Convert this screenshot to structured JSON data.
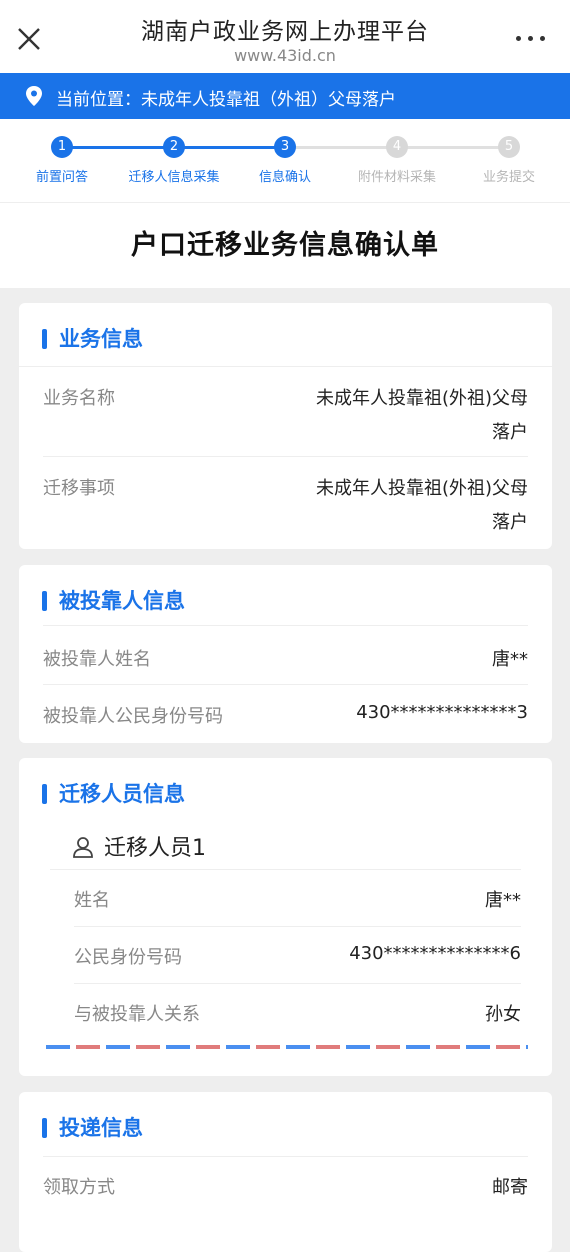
{
  "header": {
    "title": "湖南户政业务网上办理平台",
    "url": "www.43id.cn",
    "close_icon": "close-icon",
    "more_icon": "more-icon"
  },
  "location": {
    "icon": "pin-icon",
    "text": "当前位置：未成年人投靠祖（外祖）父母落户"
  },
  "steps": [
    {
      "num": "1",
      "label": "前置问答",
      "state": "active"
    },
    {
      "num": "2",
      "label": "迁移人信息采集",
      "state": "active"
    },
    {
      "num": "3",
      "label": "信息确认",
      "state": "active"
    },
    {
      "num": "4",
      "label": "附件材料采集",
      "state": "inactive"
    },
    {
      "num": "5",
      "label": "业务提交",
      "state": "inactive"
    }
  ],
  "form_title": "户口迁移业务信息确认单",
  "business": {
    "title": "业务信息",
    "rows": [
      {
        "key": "业务名称",
        "value_line1": "未成年人投靠祖(外祖)父母",
        "value_line2": "落户"
      },
      {
        "key": "迁移事项",
        "value_line1": "未成年人投靠祖(外祖)父母",
        "value_line2": "落户"
      }
    ]
  },
  "relied": {
    "title": "被投靠人信息",
    "rows": [
      {
        "key": "被投靠人姓名",
        "value": "唐**"
      },
      {
        "key": "被投靠人公民身份号码",
        "value": "430**************3"
      }
    ]
  },
  "migrants": {
    "title": "迁移人员信息",
    "person_label": "迁移人员1",
    "person_icon": "person-icon",
    "rows": [
      {
        "key": "姓名",
        "value": "唐**"
      },
      {
        "key": "公民身份号码",
        "value": "430**************6"
      },
      {
        "key": "与被投靠人关系",
        "value": "孙女"
      }
    ]
  },
  "delivery": {
    "title": "投递信息",
    "rows": [
      {
        "key": "领取方式",
        "value": "邮寄"
      }
    ]
  },
  "colors": {
    "accent": "#1a73e8",
    "inactive": "#d8d8d8",
    "envelope_blue": "#4a8ff0",
    "envelope_red": "#e07b7b"
  }
}
